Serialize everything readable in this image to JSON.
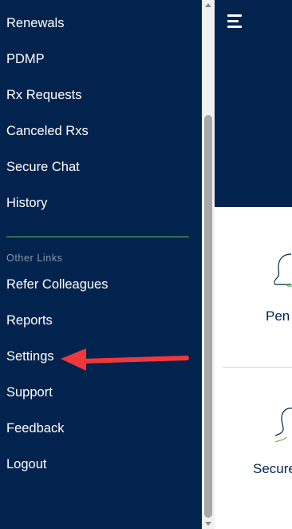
{
  "sidebar": {
    "items": [
      {
        "label": "Renewals"
      },
      {
        "label": "PDMP"
      },
      {
        "label": "Rx Requests"
      },
      {
        "label": "Canceled Rxs"
      },
      {
        "label": "Secure Chat"
      },
      {
        "label": "History"
      }
    ],
    "section_label": "Other Links",
    "other_links": [
      {
        "label": "Refer Colleagues"
      },
      {
        "label": "Reports"
      },
      {
        "label": "Settings"
      },
      {
        "label": "Support"
      },
      {
        "label": "Feedback"
      },
      {
        "label": "Logout"
      }
    ]
  },
  "main": {
    "cards": [
      {
        "label": "Pen",
        "icon": "pending-icon"
      },
      {
        "label": "Secure",
        "icon": "secure-chat-icon"
      }
    ]
  },
  "colors": {
    "sidebar_bg": "#03234f",
    "accent_divider": "#6abf4b",
    "annotation_arrow": "#f0373a"
  }
}
